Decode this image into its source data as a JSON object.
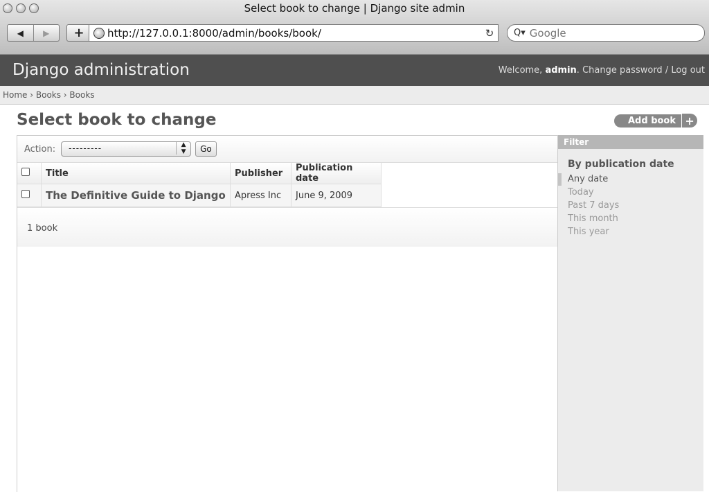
{
  "browser": {
    "window_title": "Select book to change | Django site admin",
    "url": "http://127.0.0.1:8000/admin/books/book/",
    "search_placeholder": "Google",
    "back_icon": "◀",
    "forward_icon": "▶",
    "add_tab_label": "+",
    "reload_icon": "↻"
  },
  "header": {
    "brand": "Django administration",
    "welcome": "Welcome, ",
    "username": "admin",
    "change_password": "Change password",
    "separator": " / ",
    "logout": "Log out"
  },
  "breadcrumbs": "Home › Books › Books",
  "page_title": "Select book to change",
  "add_button": {
    "label": "Add book",
    "icon": "+"
  },
  "actions": {
    "label": "Action:",
    "selected": "---------",
    "go": "Go"
  },
  "table": {
    "columns": [
      "Title",
      "Publisher",
      "Publication date"
    ],
    "rows": [
      {
        "title": "The Definitive Guide to Django",
        "publisher": "Apress Inc",
        "date": "June 9, 2009"
      }
    ]
  },
  "paginator": "1 book",
  "filter": {
    "heading": "Filter",
    "subheading": "By publication date",
    "options": [
      "Any date",
      "Today",
      "Past 7 days",
      "This month",
      "This year"
    ],
    "selected": "Any date"
  }
}
